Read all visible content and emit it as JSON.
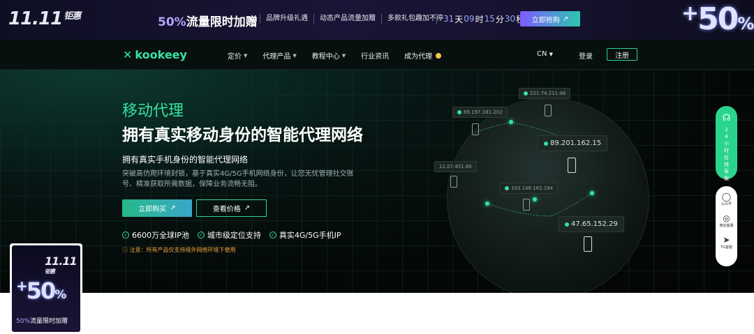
{
  "promo": {
    "logo_main": "11.11",
    "logo_sub": "钜惠",
    "headline_pct": "50%",
    "headline_text": "流量限时加赠",
    "perks": [
      "品牌升级礼遇",
      "动态产品流量加赠",
      "多款礼包趣加不停"
    ],
    "countdown": {
      "days": "31",
      "day_unit": "天",
      "hours": "09",
      "hour_unit": "时",
      "minutes": "15",
      "minute_unit": "分",
      "seconds": "30",
      "second_unit": "秒"
    },
    "buy_label": "立即抢购",
    "badge_plus": "+",
    "badge_num": "50",
    "badge_pct": "%"
  },
  "nav": {
    "brand": "kookeey",
    "menu": [
      {
        "label": "定价",
        "has_caret": true
      },
      {
        "label": "代理产品",
        "has_caret": true
      },
      {
        "label": "教程中心",
        "has_caret": true
      },
      {
        "label": "行业资讯",
        "has_caret": false
      },
      {
        "label": "成为代理",
        "has_caret": false
      }
    ],
    "lang": "CN",
    "login": "登录",
    "register": "注册"
  },
  "hero": {
    "tag": "移动代理",
    "title": "拥有真实移动身份的智能代理网络",
    "subtitle": "拥有真实手机身份的智能代理网络",
    "desc": "突破高仿爬环境封锁，基于真实4G/5G手机网络身份，让您无忧管理社交账号、精准获取所需数据，保障业务流畅无阻。",
    "buy_btn": "立即购买",
    "price_btn": "查看价格",
    "features": [
      "6600万全球IP池",
      "城市级定位支持",
      "真实4G/5G手机IP"
    ],
    "notice": "注意：所有产品仅支持境外网络环境下使用"
  },
  "map": {
    "ips": [
      "221.74.211.48",
      "89.197.181.202",
      "89.201.162.15",
      "11.07.451.80",
      "103.148.162.184",
      "47.65.152.29"
    ]
  },
  "dock": {
    "support_text": "24小时在线客服",
    "items": [
      "公众号",
      "微信客服",
      "TG客服"
    ]
  },
  "float_ad": {
    "logo_main": "11.11",
    "logo_sub": "钜惠",
    "plus": "+",
    "num": "50",
    "pct": "%",
    "caption_pct": "50%",
    "caption_text": "流量限时加赠"
  },
  "colors": {
    "accent": "#34e3a1",
    "promo_purple": "#7b5cff",
    "warning": "#f0a43c"
  }
}
